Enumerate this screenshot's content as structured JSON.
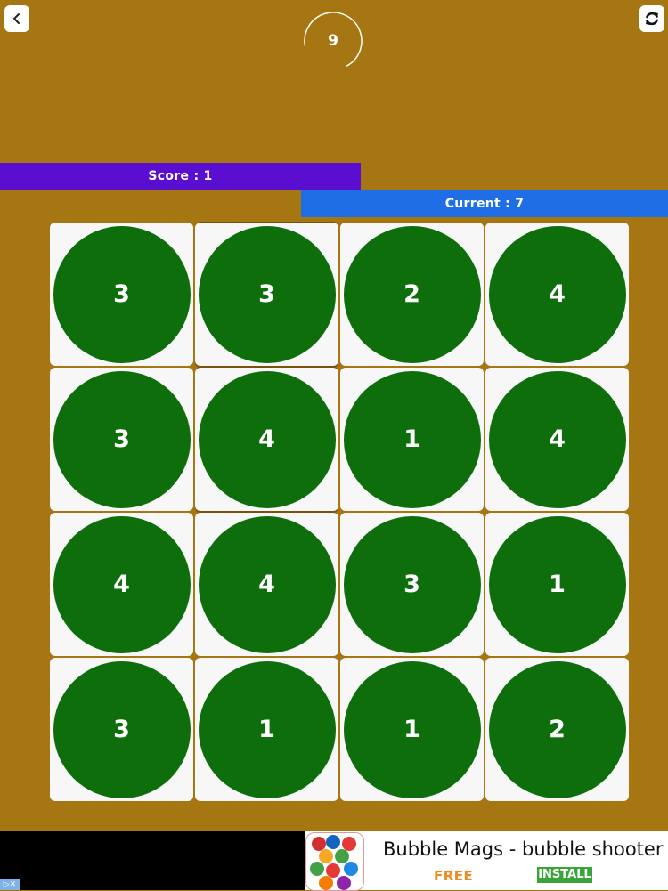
{
  "header": {
    "timer_value": "9",
    "timer_progress": 0.3,
    "back_icon": "chevron-left-icon",
    "refresh_icon": "refresh-icon"
  },
  "score": {
    "label": "Score  :  1",
    "value": 1
  },
  "current": {
    "label": "Current  :  7",
    "value": 7
  },
  "grid": {
    "rows": [
      [
        "3",
        "3",
        "2",
        "4"
      ],
      [
        "3",
        "4",
        "1",
        "4"
      ],
      [
        "4",
        "4",
        "3",
        "1"
      ],
      [
        "3",
        "1",
        "1",
        "2"
      ]
    ],
    "selected": [
      [
        0,
        1
      ],
      [
        1,
        1
      ]
    ]
  },
  "ad": {
    "title": "Bubble Mags - bubble shooter",
    "price": "FREE",
    "cta": "INSTALL",
    "marker": "▷✕"
  },
  "colors": {
    "background": "#a57612",
    "score_bar": "#5a0fd0",
    "current_bar": "#1f6ee6",
    "circle": "#0f6e0c",
    "tile": "#f7f7f8"
  }
}
